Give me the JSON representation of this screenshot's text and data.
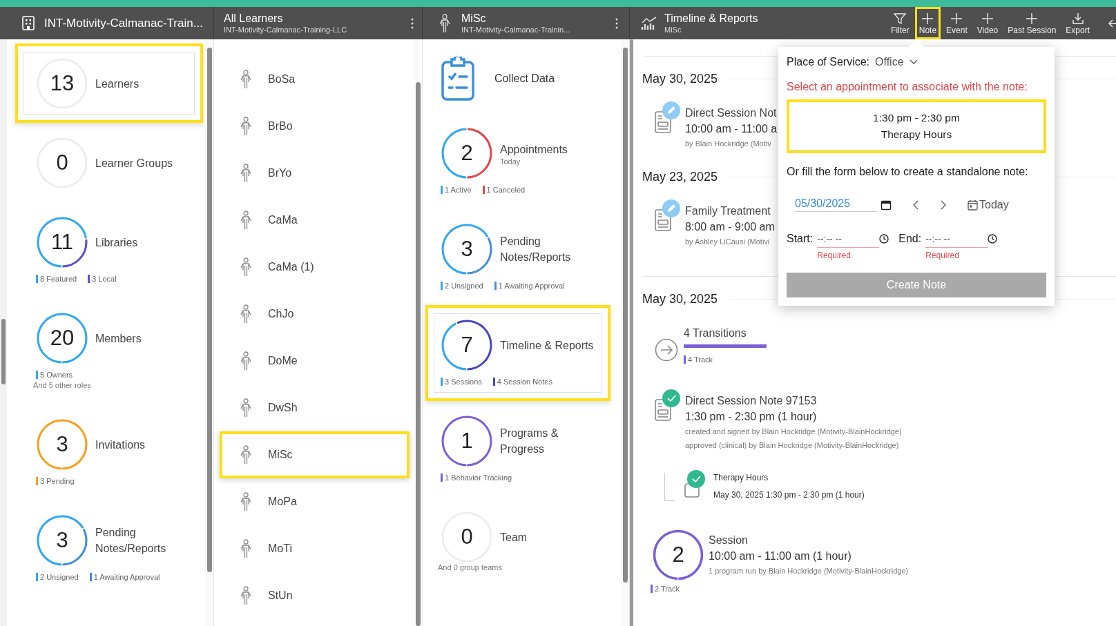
{
  "header": {
    "org": {
      "title": "INT-Motivity-Calmanac-Train..."
    },
    "learners_panel": {
      "title": "All Learners",
      "subtitle": "INT-Motivity-Calmanac-Training-LLC"
    },
    "learner_panel": {
      "title": "MiSc",
      "subtitle": "INT-Motivity-Calmanac-Trainin..."
    },
    "timeline_panel": {
      "title": "Timeline & Reports",
      "subtitle": "MiSc"
    },
    "toolbar": [
      {
        "kind": "filter",
        "label": "Filter",
        "highlighted": false
      },
      {
        "kind": "add",
        "label": "Note",
        "highlighted": true
      },
      {
        "kind": "add",
        "label": "Event",
        "highlighted": false
      },
      {
        "kind": "add",
        "label": "Video",
        "highlighted": false
      },
      {
        "kind": "add",
        "label": "Past Session",
        "highlighted": false
      },
      {
        "kind": "export",
        "label": "Export",
        "highlighted": false
      }
    ]
  },
  "org_stats": [
    {
      "count": "13",
      "label": "Learners",
      "selected": true,
      "highlighted": true
    },
    {
      "count": "0",
      "label": "Learner Groups",
      "selected": false,
      "highlighted": false
    },
    {
      "count": "11",
      "label": "Libraries",
      "selected": false,
      "highlighted": false,
      "segments": [
        {
          "color": "#2ea8f2",
          "level": 0.727
        },
        {
          "color": "#5b4fd0",
          "level": 0.273
        }
      ],
      "legend": [
        {
          "text": "8 Featured",
          "color": "#2ea8f2"
        },
        {
          "text": "3 Local",
          "color": "#5b4fd0"
        }
      ]
    },
    {
      "count": "20",
      "label": "Members",
      "selected": false,
      "highlighted": false,
      "segments": [
        {
          "color": "#2ea8f2",
          "level": 1
        }
      ],
      "legend": [
        {
          "text": "5 Owners",
          "color": "#2ea8f2"
        }
      ],
      "note": "And 5 other roles"
    },
    {
      "count": "3",
      "label": "Invitations",
      "selected": false,
      "highlighted": false,
      "segments": [
        {
          "color": "#f7a21b",
          "level": 1
        }
      ],
      "legend": [
        {
          "text": "3 Pending",
          "color": "#f7a21b"
        }
      ]
    },
    {
      "count": "3",
      "label": "Pending Notes/Reports",
      "selected": false,
      "highlighted": false,
      "segments": [
        {
          "color": "#2ea8f2",
          "level": 0.667
        },
        {
          "color": "#3f8fdc",
          "level": 0.333
        }
      ],
      "legend": [
        {
          "text": "2 Unsigned",
          "color": "#2ea8f2"
        },
        {
          "text": "1 Awaiting Approval",
          "color": "#3f8fdc"
        }
      ]
    }
  ],
  "learners": [
    {
      "name": "BoSa",
      "selected": false,
      "highlighted": false
    },
    {
      "name": "BrBo",
      "selected": false,
      "highlighted": false
    },
    {
      "name": "BrYo",
      "selected": false,
      "highlighted": false
    },
    {
      "name": "CaMa",
      "selected": false,
      "highlighted": false
    },
    {
      "name": "CaMa (1)",
      "selected": false,
      "highlighted": false
    },
    {
      "name": "ChJo",
      "selected": false,
      "highlighted": false
    },
    {
      "name": "DoMe",
      "selected": false,
      "highlighted": false
    },
    {
      "name": "DwSh",
      "selected": false,
      "highlighted": false
    },
    {
      "name": "MiSc",
      "selected": true,
      "highlighted": true
    },
    {
      "name": "MoPa",
      "selected": false,
      "highlighted": false
    },
    {
      "name": "MoTi",
      "selected": false,
      "highlighted": false
    },
    {
      "name": "StUn",
      "selected": false,
      "highlighted": false
    }
  ],
  "learner_menu": [
    {
      "kind": "action",
      "label": "Collect Data"
    },
    {
      "kind": "stat",
      "count": "2",
      "label": "Appointments",
      "sublabel": "Today",
      "selected": false,
      "highlighted": false,
      "segments": [
        {
          "color": "#2ea8f2",
          "level": 0.5
        },
        {
          "color": "#e0474c",
          "level": 0.5
        }
      ],
      "legend": [
        {
          "text": "1 Active",
          "color": "#2ea8f2"
        },
        {
          "text": "1 Canceled",
          "color": "#e0474c"
        }
      ]
    },
    {
      "kind": "stat",
      "count": "3",
      "label": "Pending Notes/Reports",
      "selected": false,
      "highlighted": false,
      "segments": [
        {
          "color": "#2ea8f2",
          "level": 0.667
        },
        {
          "color": "#3f8fdc",
          "level": 0.333
        }
      ],
      "legend": [
        {
          "text": "2 Unsigned",
          "color": "#2ea8f2"
        },
        {
          "text": "1 Awaiting Approval",
          "color": "#3f8fdc"
        }
      ]
    },
    {
      "kind": "stat",
      "count": "7",
      "label": "Timeline & Reports",
      "selected": true,
      "highlighted": true,
      "segments": [
        {
          "color": "#2ea8f2",
          "level": 0.429
        },
        {
          "color": "#4b45c4",
          "level": 0.571
        }
      ],
      "legend": [
        {
          "text": "3 Sessions",
          "color": "#2ea8f2"
        },
        {
          "text": "4 Session Notes",
          "color": "#4b45c4"
        }
      ]
    },
    {
      "kind": "stat",
      "count": "1",
      "label": "Programs & Progress",
      "selected": false,
      "highlighted": false,
      "segments": [
        {
          "color": "#7b5fd6",
          "level": 1
        }
      ],
      "legend": [
        {
          "text": "1 Behavior Tracking",
          "color": "#7b5fd6"
        }
      ]
    },
    {
      "kind": "stat",
      "count": "0",
      "label": "Team",
      "selected": false,
      "highlighted": false,
      "note": "And 0 group teams"
    }
  ],
  "timeline": [
    {
      "kind": "divider"
    },
    {
      "kind": "date",
      "label": "May 30, 2025"
    },
    {
      "kind": "note",
      "approved": false,
      "title": "Direct Session Not",
      "time": "10:00 am - 11:00 a",
      "lines": [
        "by Blain Hockridge (Motiv"
      ]
    },
    {
      "kind": "date",
      "label": "May 23, 2025"
    },
    {
      "kind": "note",
      "approved": false,
      "title": "Family Treatment",
      "time": "8:00 am - 9:00 am",
      "lines": [
        "by Ashley LiCausi (Motivi"
      ]
    },
    {
      "kind": "divider"
    },
    {
      "kind": "date",
      "label": "May 30, 2025"
    },
    {
      "kind": "transitions",
      "title": "4 Transitions",
      "legend": [
        {
          "text": "4 Track",
          "color": "#7b5fd6"
        }
      ]
    },
    {
      "kind": "note",
      "approved": true,
      "title": "Direct Session Note 97153",
      "time": "1:30 pm - 2:30 pm (1 hour)",
      "lines": [
        "created and signed by Blain Hockridge (Motivity-BlainHockridge)",
        "approved (clinical) by Blain Hockridge (Motivity-BlainHockridge)"
      ],
      "children": [
        {
          "kind": "appointment",
          "approved": true,
          "title": "Therapy Hours",
          "time": "May 30, 2025 1:30 pm - 2:30 pm (1 hour)"
        }
      ]
    },
    {
      "kind": "session",
      "count": "2",
      "segments": [
        {
          "color": "#7b5fd6",
          "level": 1
        }
      ],
      "title": "Session",
      "time": "10:00 am - 11:00 am (1 hour)",
      "lines": [
        "1 program run by Blain Hockridge (Motivity-BlainHockridge)"
      ],
      "legend": [
        {
          "text": "2 Track",
          "color": "#7b5fd6"
        }
      ]
    }
  ],
  "note_popup": {
    "place_label": "Place of Service:",
    "place_value": "Office",
    "prompt": "Select an appointment to associate with the note:",
    "appointments": [
      {
        "time": "1:30 pm - 2:30 pm",
        "title": "Therapy Hours",
        "highlighted": true
      }
    ],
    "alt_prompt": "Or fill the form below to create a standalone note:",
    "date": "05/30/2025",
    "today": "Today",
    "start": {
      "label": "Start:",
      "placeholder": "--:-- --",
      "error": "Required"
    },
    "end": {
      "label": "End:",
      "placeholder": "--:-- --",
      "error": "Required"
    },
    "submit": {
      "label": "Create Note",
      "disabled": true
    }
  }
}
